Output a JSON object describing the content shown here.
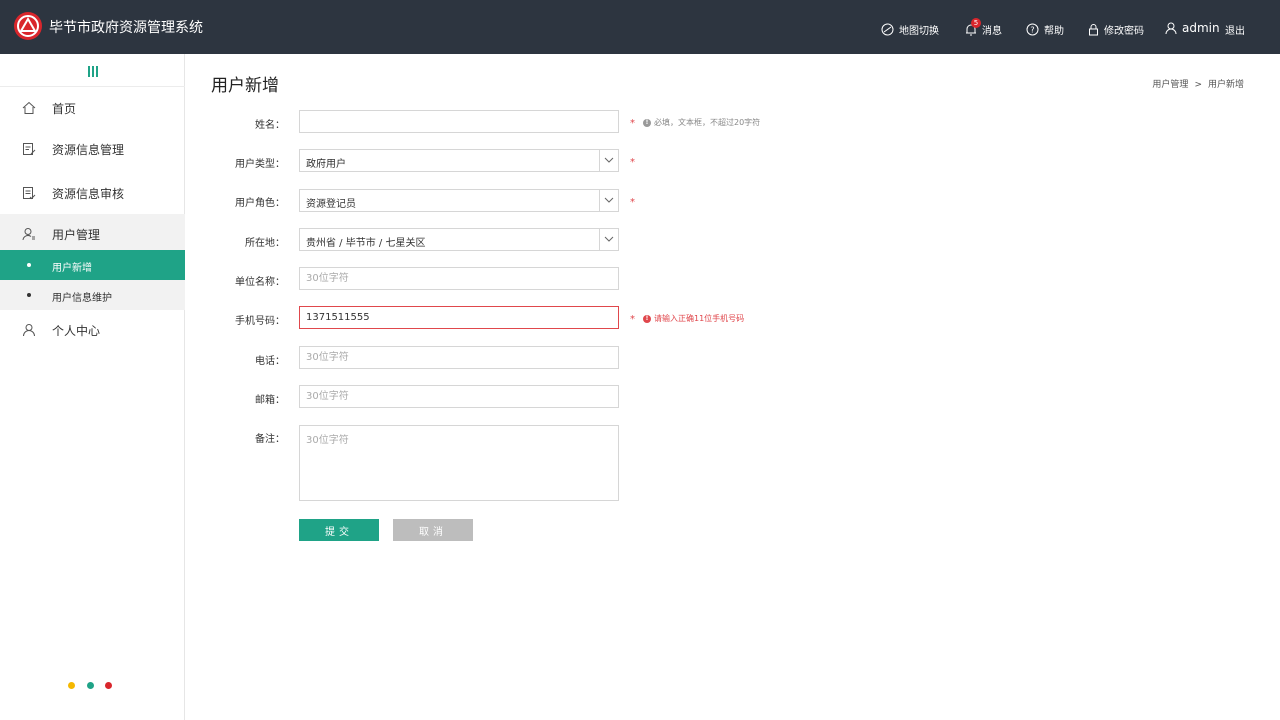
{
  "header": {
    "title": "毕节市政府资源管理系统",
    "map_switch": "地图切换",
    "messages": "消息",
    "message_count": "5",
    "help": "帮助",
    "change_password": "修改密码",
    "username": "admin",
    "logout": "退出"
  },
  "sidebar": {
    "items": [
      {
        "label": "首页"
      },
      {
        "label": "资源信息管理"
      },
      {
        "label": "资源信息审核"
      },
      {
        "label": "用户管理"
      },
      {
        "label": "个人中心"
      }
    ],
    "sub_items": [
      {
        "label": "用户新增",
        "active": true
      },
      {
        "label": "用户信息维护",
        "active": false
      }
    ],
    "dot_colors": [
      "#f5b800",
      "#1fa387",
      "#d9262c"
    ]
  },
  "page": {
    "title": "用户新增",
    "breadcrumb": [
      "用户管理",
      "用户新增"
    ],
    "breadcrumb_sep": ">"
  },
  "form": {
    "name_label": "姓名：",
    "name_value": "",
    "name_hint": "必填，文本框，不超过20字符",
    "user_type_label": "用户类型：",
    "user_type_value": "政府用户",
    "user_role_label": "用户角色：",
    "user_role_value": "资源登记员",
    "location_label": "所在地：",
    "location_value": "贵州省 / 毕节市 / 七星关区",
    "org_label": "单位名称：",
    "org_placeholder": "30位字符",
    "phone_label": "手机号码：",
    "phone_value": "1371511555",
    "phone_error": "请输入正确11位手机号码",
    "tel_label": "电话：",
    "tel_placeholder": "30位字符",
    "email_label": "邮箱：",
    "email_placeholder": "30位字符",
    "remark_label": "备注：",
    "remark_placeholder": "30位字符",
    "required_mark": "*",
    "submit_label": "提交",
    "cancel_label": "取消"
  },
  "colors": {
    "header_bg": "#2d3540",
    "accent": "#1fa387",
    "error": "#e0474c",
    "brand_red": "#d9262c"
  }
}
